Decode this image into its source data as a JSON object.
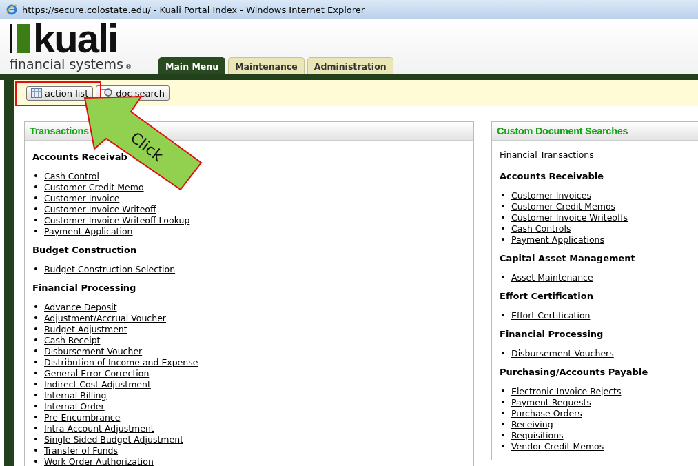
{
  "window": {
    "title": "https://secure.colostate.edu/ - Kuali Portal Index - Windows Internet Explorer"
  },
  "logo": {
    "wordmark": "kuali",
    "tagline": "financial systems",
    "mark": "®"
  },
  "tabs": [
    {
      "label": "Main Menu",
      "selected": true
    },
    {
      "label": "Maintenance",
      "selected": false
    },
    {
      "label": "Administration",
      "selected": false
    }
  ],
  "toolbar": [
    {
      "label": "action list",
      "kind": "table"
    },
    {
      "label": "doc search",
      "kind": "search"
    }
  ],
  "callout": {
    "label": "Click"
  },
  "panels": [
    {
      "title": "Transactions",
      "sections": [
        {
          "heading": "Accounts Receivab",
          "links": [
            "Cash Control",
            "Customer Credit Memo",
            "Customer Invoice",
            "Customer Invoice Writeoff",
            "Customer Invoice Writeoff Lookup",
            "Payment Application"
          ]
        },
        {
          "heading": "Budget Construction",
          "links": [
            "Budget Construction Selection"
          ]
        },
        {
          "heading": "Financial Processing",
          "links": [
            "Advance Deposit",
            "Adjustment/Accrual Voucher",
            "Budget Adjustment",
            "Cash Receipt",
            "Disbursement Voucher",
            "Distribution of Income and Expense",
            "General Error Correction",
            "Indirect Cost Adjustment",
            "Internal Billing",
            "Internal Order",
            "Pre-Encumbrance",
            "Intra-Account Adjustment",
            "Single Sided Budget Adjustment",
            "Transfer of Funds",
            "Work Order Authorization"
          ]
        }
      ]
    },
    {
      "title": "Custom Document Searches",
      "top_link": "Financial Transactions",
      "sections": [
        {
          "heading": "Accounts Receivable",
          "links": [
            "Customer Invoices",
            "Customer Credit Memos",
            "Customer Invoice Writeoffs",
            "Cash Controls",
            "Payment Applications"
          ]
        },
        {
          "heading": "Capital Asset Management",
          "links": [
            "Asset Maintenance"
          ]
        },
        {
          "heading": "Effort Certification",
          "links": [
            "Effort Certification"
          ]
        },
        {
          "heading": "Financial Processing",
          "links": [
            "Disbursement Vouchers"
          ]
        },
        {
          "heading": "Purchasing/Accounts Payable",
          "links": [
            "Electronic Invoice Rejects",
            "Payment Requests",
            "Purchase Orders",
            "Receiving",
            "Requisitions",
            "Vendor Credit Memos"
          ]
        }
      ]
    }
  ]
}
